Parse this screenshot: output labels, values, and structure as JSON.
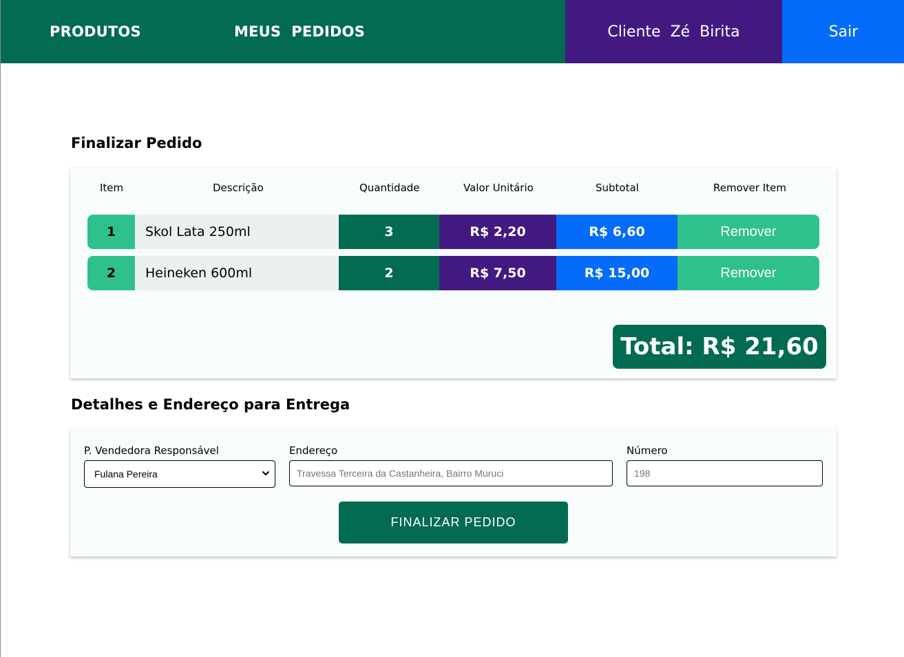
{
  "header": {
    "products_label": "PRODUTOS",
    "orders_label": "MEUS  PEDIDOS",
    "client_label": "Cliente  Zé  Birita",
    "logout_label": "Sair"
  },
  "checkout": {
    "title": "Finalizar Pedido",
    "columns": [
      "Item",
      "Descrição",
      "Quantidade",
      "Valor Unitário",
      "Subtotal",
      "Remover Item"
    ],
    "rows": [
      {
        "item": "1",
        "description": "Skol Lata 250ml",
        "quantity": "3",
        "unit_price": "R$ 2,20",
        "subtotal": "R$ 6,60",
        "remove_label": "Remover"
      },
      {
        "item": "2",
        "description": "Heineken 600ml",
        "quantity": "2",
        "unit_price": "R$ 7,50",
        "subtotal": "R$ 15,00",
        "remove_label": "Remover"
      }
    ],
    "total": "Total: R$ 21,60"
  },
  "delivery": {
    "title": "Detalhes e Endereço para Entrega",
    "seller_label": "P. Vendedora Responsável",
    "seller_selected": "Fulana Pereira",
    "address_label": "Endereço",
    "address_placeholder": "Travessa Terceira da Castanheira, Bairro Muruci",
    "number_label": "Número",
    "number_placeholder": "198",
    "submit_label": "FINALIZAR PEDIDO"
  },
  "colors": {
    "green": "#036b52",
    "purple": "#421981",
    "blue": "#056cf9",
    "light_green": "#2fc18c"
  }
}
